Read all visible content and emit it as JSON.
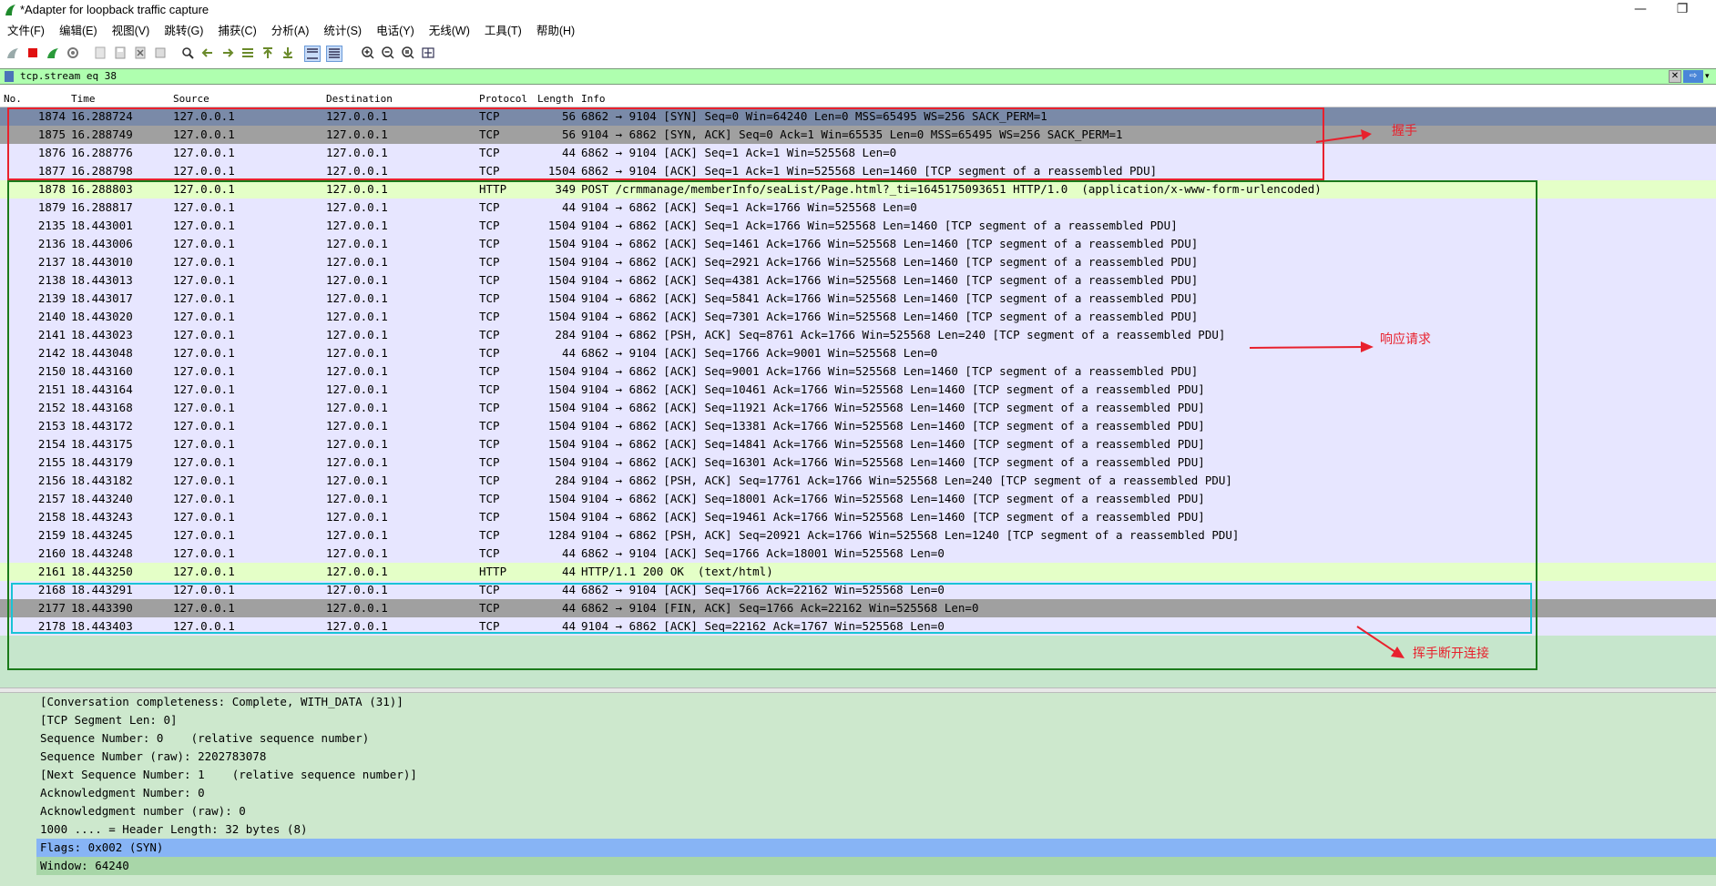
{
  "window": {
    "title": "*Adapter for loopback traffic capture",
    "minimize": "—",
    "restore": "❐"
  },
  "menu": [
    "文件(F)",
    "编辑(E)",
    "视图(V)",
    "跳转(G)",
    "捕获(C)",
    "分析(A)",
    "统计(S)",
    "电话(Y)",
    "无线(W)",
    "工具(T)",
    "帮助(H)"
  ],
  "filter": {
    "value": "tcp.stream eq 38",
    "clear": "✕",
    "apply": "⇨",
    "dropdown": "▾"
  },
  "columns": {
    "no": "No.",
    "time": "Time",
    "source": "Source",
    "destination": "Destination",
    "protocol": "Protocol",
    "length": "Length",
    "info": "Info"
  },
  "packets": [
    {
      "no": "1874",
      "time": "16.288724",
      "src": "127.0.0.1",
      "dst": "127.0.0.1",
      "proto": "TCP",
      "len": "56",
      "info": "6862 → 9104 [SYN] Seq=0 Win=64240 Len=0 MSS=65495 WS=256 SACK_PERM=1",
      "style": "sel"
    },
    {
      "no": "1875",
      "time": "16.288749",
      "src": "127.0.0.1",
      "dst": "127.0.0.1",
      "proto": "TCP",
      "len": "56",
      "info": "9104 → 6862 [SYN, ACK] Seq=0 Ack=1 Win=65535 Len=0 MSS=65495 WS=256 SACK_PERM=1",
      "style": "dark"
    },
    {
      "no": "1876",
      "time": "16.288776",
      "src": "127.0.0.1",
      "dst": "127.0.0.1",
      "proto": "TCP",
      "len": "44",
      "info": "6862 → 9104 [ACK] Seq=1 Ack=1 Win=525568 Len=0",
      "style": "tcp"
    },
    {
      "no": "1877",
      "time": "16.288798",
      "src": "127.0.0.1",
      "dst": "127.0.0.1",
      "proto": "TCP",
      "len": "1504",
      "info": "6862 → 9104 [ACK] Seq=1 Ack=1 Win=525568 Len=1460 [TCP segment of a reassembled PDU]",
      "style": "tcp"
    },
    {
      "no": "1878",
      "time": "16.288803",
      "src": "127.0.0.1",
      "dst": "127.0.0.1",
      "proto": "HTTP",
      "len": "349",
      "info": "POST /crmmanage/memberInfo/seaList/Page.html?_ti=1645175093651 HTTP/1.0  (application/x-www-form-urlencoded)",
      "style": "http"
    },
    {
      "no": "1879",
      "time": "16.288817",
      "src": "127.0.0.1",
      "dst": "127.0.0.1",
      "proto": "TCP",
      "len": "44",
      "info": "9104 → 6862 [ACK] Seq=1 Ack=1766 Win=525568 Len=0",
      "style": "tcp"
    },
    {
      "no": "2135",
      "time": "18.443001",
      "src": "127.0.0.1",
      "dst": "127.0.0.1",
      "proto": "TCP",
      "len": "1504",
      "info": "9104 → 6862 [ACK] Seq=1 Ack=1766 Win=525568 Len=1460 [TCP segment of a reassembled PDU]",
      "style": "tcp"
    },
    {
      "no": "2136",
      "time": "18.443006",
      "src": "127.0.0.1",
      "dst": "127.0.0.1",
      "proto": "TCP",
      "len": "1504",
      "info": "9104 → 6862 [ACK] Seq=1461 Ack=1766 Win=525568 Len=1460 [TCP segment of a reassembled PDU]",
      "style": "tcp"
    },
    {
      "no": "2137",
      "time": "18.443010",
      "src": "127.0.0.1",
      "dst": "127.0.0.1",
      "proto": "TCP",
      "len": "1504",
      "info": "9104 → 6862 [ACK] Seq=2921 Ack=1766 Win=525568 Len=1460 [TCP segment of a reassembled PDU]",
      "style": "tcp"
    },
    {
      "no": "2138",
      "time": "18.443013",
      "src": "127.0.0.1",
      "dst": "127.0.0.1",
      "proto": "TCP",
      "len": "1504",
      "info": "9104 → 6862 [ACK] Seq=4381 Ack=1766 Win=525568 Len=1460 [TCP segment of a reassembled PDU]",
      "style": "tcp"
    },
    {
      "no": "2139",
      "time": "18.443017",
      "src": "127.0.0.1",
      "dst": "127.0.0.1",
      "proto": "TCP",
      "len": "1504",
      "info": "9104 → 6862 [ACK] Seq=5841 Ack=1766 Win=525568 Len=1460 [TCP segment of a reassembled PDU]",
      "style": "tcp"
    },
    {
      "no": "2140",
      "time": "18.443020",
      "src": "127.0.0.1",
      "dst": "127.0.0.1",
      "proto": "TCP",
      "len": "1504",
      "info": "9104 → 6862 [ACK] Seq=7301 Ack=1766 Win=525568 Len=1460 [TCP segment of a reassembled PDU]",
      "style": "tcp"
    },
    {
      "no": "2141",
      "time": "18.443023",
      "src": "127.0.0.1",
      "dst": "127.0.0.1",
      "proto": "TCP",
      "len": "284",
      "info": "9104 → 6862 [PSH, ACK] Seq=8761 Ack=1766 Win=525568 Len=240 [TCP segment of a reassembled PDU]",
      "style": "tcp"
    },
    {
      "no": "2142",
      "time": "18.443048",
      "src": "127.0.0.1",
      "dst": "127.0.0.1",
      "proto": "TCP",
      "len": "44",
      "info": "6862 → 9104 [ACK] Seq=1766 Ack=9001 Win=525568 Len=0",
      "style": "tcp"
    },
    {
      "no": "2150",
      "time": "18.443160",
      "src": "127.0.0.1",
      "dst": "127.0.0.1",
      "proto": "TCP",
      "len": "1504",
      "info": "9104 → 6862 [ACK] Seq=9001 Ack=1766 Win=525568 Len=1460 [TCP segment of a reassembled PDU]",
      "style": "tcp"
    },
    {
      "no": "2151",
      "time": "18.443164",
      "src": "127.0.0.1",
      "dst": "127.0.0.1",
      "proto": "TCP",
      "len": "1504",
      "info": "9104 → 6862 [ACK] Seq=10461 Ack=1766 Win=525568 Len=1460 [TCP segment of a reassembled PDU]",
      "style": "tcp"
    },
    {
      "no": "2152",
      "time": "18.443168",
      "src": "127.0.0.1",
      "dst": "127.0.0.1",
      "proto": "TCP",
      "len": "1504",
      "info": "9104 → 6862 [ACK] Seq=11921 Ack=1766 Win=525568 Len=1460 [TCP segment of a reassembled PDU]",
      "style": "tcp"
    },
    {
      "no": "2153",
      "time": "18.443172",
      "src": "127.0.0.1",
      "dst": "127.0.0.1",
      "proto": "TCP",
      "len": "1504",
      "info": "9104 → 6862 [ACK] Seq=13381 Ack=1766 Win=525568 Len=1460 [TCP segment of a reassembled PDU]",
      "style": "tcp"
    },
    {
      "no": "2154",
      "time": "18.443175",
      "src": "127.0.0.1",
      "dst": "127.0.0.1",
      "proto": "TCP",
      "len": "1504",
      "info": "9104 → 6862 [ACK] Seq=14841 Ack=1766 Win=525568 Len=1460 [TCP segment of a reassembled PDU]",
      "style": "tcp"
    },
    {
      "no": "2155",
      "time": "18.443179",
      "src": "127.0.0.1",
      "dst": "127.0.0.1",
      "proto": "TCP",
      "len": "1504",
      "info": "9104 → 6862 [ACK] Seq=16301 Ack=1766 Win=525568 Len=1460 [TCP segment of a reassembled PDU]",
      "style": "tcp"
    },
    {
      "no": "2156",
      "time": "18.443182",
      "src": "127.0.0.1",
      "dst": "127.0.0.1",
      "proto": "TCP",
      "len": "284",
      "info": "9104 → 6862 [PSH, ACK] Seq=17761 Ack=1766 Win=525568 Len=240 [TCP segment of a reassembled PDU]",
      "style": "tcp"
    },
    {
      "no": "2157",
      "time": "18.443240",
      "src": "127.0.0.1",
      "dst": "127.0.0.1",
      "proto": "TCP",
      "len": "1504",
      "info": "9104 → 6862 [ACK] Seq=18001 Ack=1766 Win=525568 Len=1460 [TCP segment of a reassembled PDU]",
      "style": "tcp"
    },
    {
      "no": "2158",
      "time": "18.443243",
      "src": "127.0.0.1",
      "dst": "127.0.0.1",
      "proto": "TCP",
      "len": "1504",
      "info": "9104 → 6862 [ACK] Seq=19461 Ack=1766 Win=525568 Len=1460 [TCP segment of a reassembled PDU]",
      "style": "tcp"
    },
    {
      "no": "2159",
      "time": "18.443245",
      "src": "127.0.0.1",
      "dst": "127.0.0.1",
      "proto": "TCP",
      "len": "1284",
      "info": "9104 → 6862 [PSH, ACK] Seq=20921 Ack=1766 Win=525568 Len=1240 [TCP segment of a reassembled PDU]",
      "style": "tcp"
    },
    {
      "no": "2160",
      "time": "18.443248",
      "src": "127.0.0.1",
      "dst": "127.0.0.1",
      "proto": "TCP",
      "len": "44",
      "info": "6862 → 9104 [ACK] Seq=1766 Ack=18001 Win=525568 Len=0",
      "style": "tcp"
    },
    {
      "no": "2161",
      "time": "18.443250",
      "src": "127.0.0.1",
      "dst": "127.0.0.1",
      "proto": "HTTP",
      "len": "44",
      "info": "HTTP/1.1 200 OK  (text/html)",
      "style": "http"
    },
    {
      "no": "2168",
      "time": "18.443291",
      "src": "127.0.0.1",
      "dst": "127.0.0.1",
      "proto": "TCP",
      "len": "44",
      "info": "6862 → 9104 [ACK] Seq=1766 Ack=22162 Win=525568 Len=0",
      "style": "tcp"
    },
    {
      "no": "2177",
      "time": "18.443390",
      "src": "127.0.0.1",
      "dst": "127.0.0.1",
      "proto": "TCP",
      "len": "44",
      "info": "6862 → 9104 [FIN, ACK] Seq=1766 Ack=22162 Win=525568 Len=0",
      "style": "dark"
    },
    {
      "no": "2178",
      "time": "18.443403",
      "src": "127.0.0.1",
      "dst": "127.0.0.1",
      "proto": "TCP",
      "len": "44",
      "info": "9104 → 6862 [ACK] Seq=22162 Ack=1767 Win=525568 Len=0",
      "style": "tcp"
    }
  ],
  "annotations": {
    "handshake": "握手",
    "response": "响应请求",
    "teardown": "挥手断开连接",
    "colors": {
      "handshake": "#e8212d",
      "response": "#1a7a1a",
      "teardown": "#19c3d6",
      "arrow": "#e8212d"
    }
  },
  "details": [
    {
      "text": "[Conversation completeness: Complete, WITH_DATA (31)]",
      "style": ""
    },
    {
      "text": "[TCP Segment Len: 0]",
      "style": ""
    },
    {
      "text": "Sequence Number: 0    (relative sequence number)",
      "style": ""
    },
    {
      "text": "Sequence Number (raw): 2202783078",
      "style": ""
    },
    {
      "text": "[Next Sequence Number: 1    (relative sequence number)]",
      "style": ""
    },
    {
      "text": "Acknowledgment Number: 0",
      "style": ""
    },
    {
      "text": "Acknowledgment number (raw): 0",
      "style": ""
    },
    {
      "text": "1000 .... = Header Length: 32 bytes (8)",
      "style": ""
    },
    {
      "text": "Flags: 0x002 (SYN)",
      "style": "hl",
      "expander": "›"
    },
    {
      "text": "Window: 64240",
      "style": "win"
    }
  ]
}
